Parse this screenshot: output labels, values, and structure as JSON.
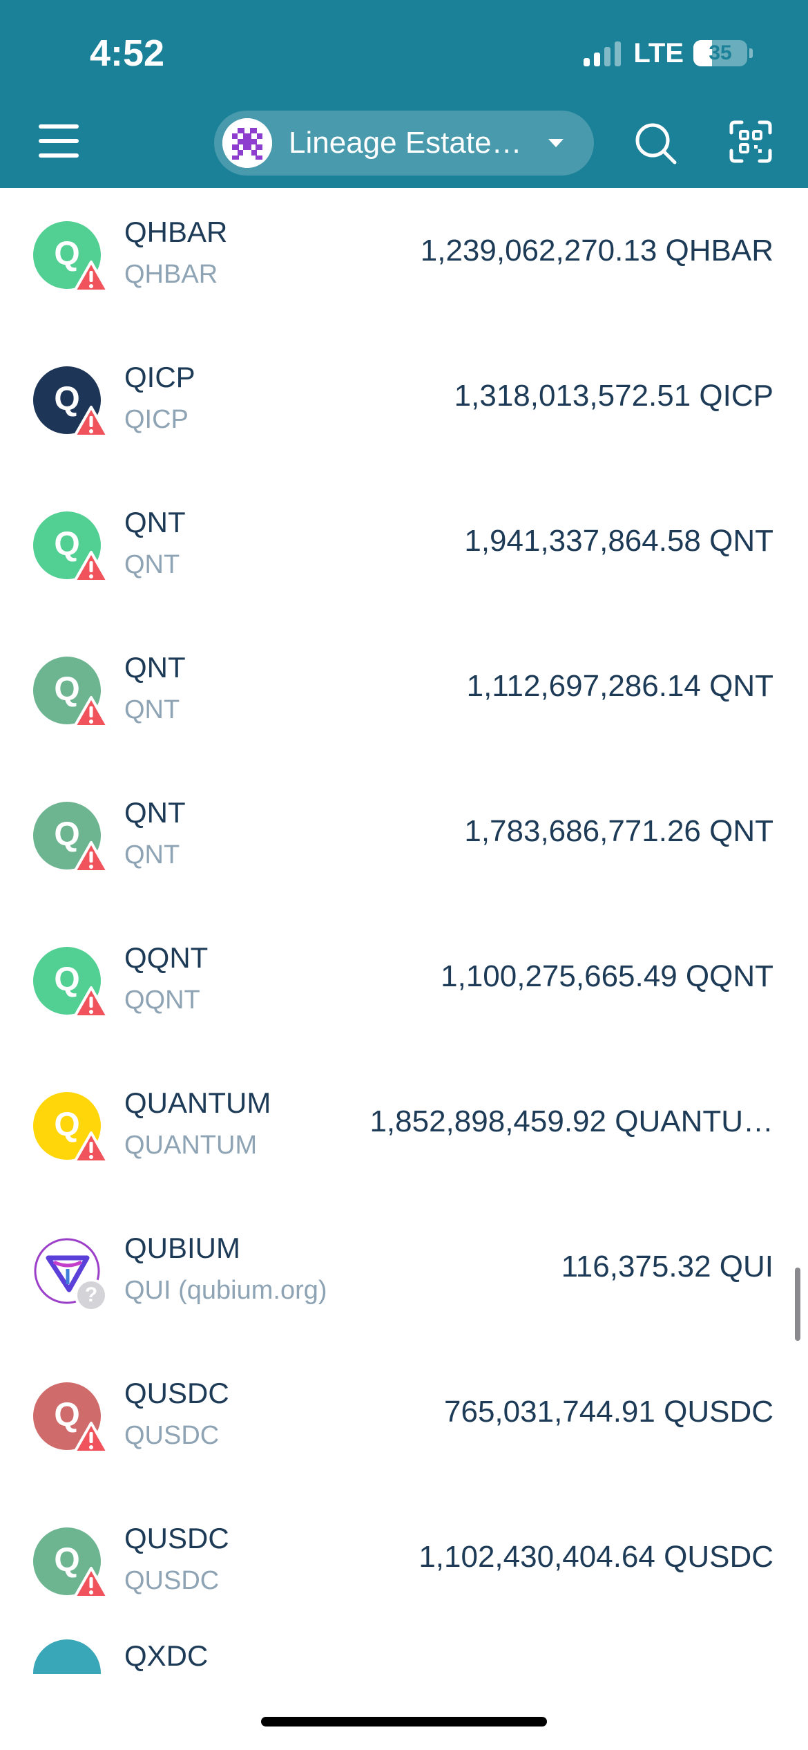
{
  "status_bar": {
    "time": "4:52",
    "network": "LTE",
    "battery": "35",
    "battery_level": 0.35
  },
  "header": {
    "account_name": "Lineage Estate…",
    "icons": {
      "menu": "hamburger-menu-icon",
      "search": "search-icon",
      "scan": "qr-scan-icon",
      "dropdown": "chevron-down-icon"
    }
  },
  "tokens": [
    {
      "name": "QHBAR",
      "subtitle": "QHBAR",
      "amount": "1,239,062,270.13 QHBAR",
      "icon_letter": "Q",
      "icon_color": "#52cf93",
      "badge": "warning"
    },
    {
      "name": "QICP",
      "subtitle": "QICP",
      "amount": "1,318,013,572.51 QICP",
      "icon_letter": "Q",
      "icon_color": "#1d3557",
      "badge": "warning"
    },
    {
      "name": "QNT",
      "subtitle": "QNT",
      "amount": "1,941,337,864.58 QNT",
      "icon_letter": "Q",
      "icon_color": "#52cf93",
      "badge": "warning"
    },
    {
      "name": "QNT",
      "subtitle": "QNT",
      "amount": "1,112,697,286.14 QNT",
      "icon_letter": "Q",
      "icon_color": "#6db590",
      "badge": "warning"
    },
    {
      "name": "QNT",
      "subtitle": "QNT",
      "amount": "1,783,686,771.26 QNT",
      "icon_letter": "Q",
      "icon_color": "#6db590",
      "badge": "warning"
    },
    {
      "name": "QQNT",
      "subtitle": "QQNT",
      "amount": "1,100,275,665.49 QQNT",
      "icon_letter": "Q",
      "icon_color": "#52cf93",
      "badge": "warning"
    },
    {
      "name": "QUANTUM",
      "subtitle": "QUANTUM",
      "amount": "1,852,898,459.92 QUANTU…",
      "icon_letter": "Q",
      "icon_color": "#ffd60a",
      "badge": "warning"
    },
    {
      "name": "QUBIUM",
      "subtitle": "QUI (qubium.org)",
      "amount": "116,375.32 QUI",
      "icon_letter": "",
      "icon_color": "#ffffff",
      "badge": "unknown"
    },
    {
      "name": "QUSDC",
      "subtitle": "QUSDC",
      "amount": "765,031,744.91 QUSDC",
      "icon_letter": "Q",
      "icon_color": "#d06b6b",
      "badge": "warning"
    },
    {
      "name": "QUSDC",
      "subtitle": "QUSDC",
      "amount": "1,102,430,404.64 QUSDC",
      "icon_letter": "Q",
      "icon_color": "#6db590",
      "badge": "warning"
    }
  ],
  "partial_token": {
    "name": "QXDC",
    "icon_color": "#3aa7b8"
  }
}
